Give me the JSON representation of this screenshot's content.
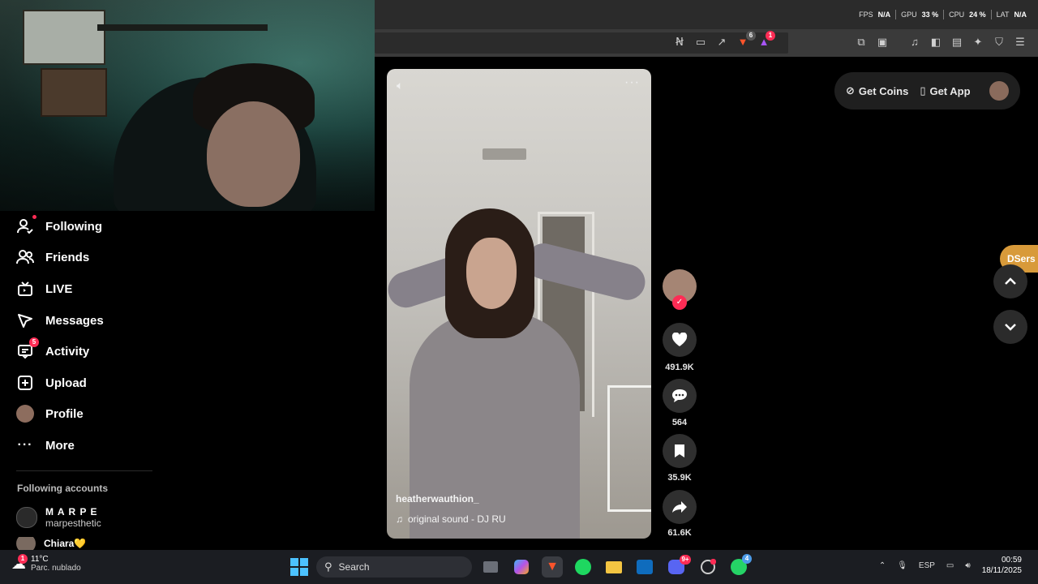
{
  "browser": {
    "stats": {
      "fps_label": "FPS",
      "fps_value": "N/A",
      "gpu_label": "GPU",
      "gpu_value": "33 %",
      "cpu_label": "CPU",
      "cpu_value": "24 %",
      "lat_label": "LAT",
      "lat_value": "N/A"
    },
    "brave_badge": "6",
    "alert_badge": "1"
  },
  "sidebar": {
    "items": [
      {
        "label": "Following",
        "icon": "following-icon"
      },
      {
        "label": "Friends",
        "icon": "friends-icon"
      },
      {
        "label": "LIVE",
        "icon": "live-icon"
      },
      {
        "label": "Messages",
        "icon": "messages-icon"
      },
      {
        "label": "Activity",
        "icon": "activity-icon",
        "badge": "5"
      },
      {
        "label": "Upload",
        "icon": "upload-icon"
      },
      {
        "label": "Profile",
        "icon": "avatar"
      },
      {
        "label": "More",
        "icon": "more-icon"
      }
    ],
    "following_title": "Following accounts",
    "accounts": [
      {
        "name": "M A R P E",
        "handle": "marpesthetic"
      },
      {
        "name": "Chiara💛",
        "handle": ""
      }
    ]
  },
  "video": {
    "username": "heatherwauthion_",
    "sound": "original sound - DJ RU"
  },
  "actions": {
    "likes": "491.9K",
    "comments": "564",
    "saves": "35.9K",
    "shares": "61.6K"
  },
  "header": {
    "get_coins": "Get Coins",
    "get_app": "Get App"
  },
  "extension": {
    "dsers": "DSers"
  },
  "taskbar": {
    "weather_temp": "11°C",
    "weather_desc": "Parc. nublado",
    "weather_badge": "1",
    "search": "Search",
    "discord_badge": "9+",
    "whatsapp_badge": "4",
    "lang": "ESP",
    "time": "00:59",
    "date": "18/11/2025"
  },
  "colors": {
    "accent": "#fe2c55",
    "dsers": "#d89a3a"
  }
}
